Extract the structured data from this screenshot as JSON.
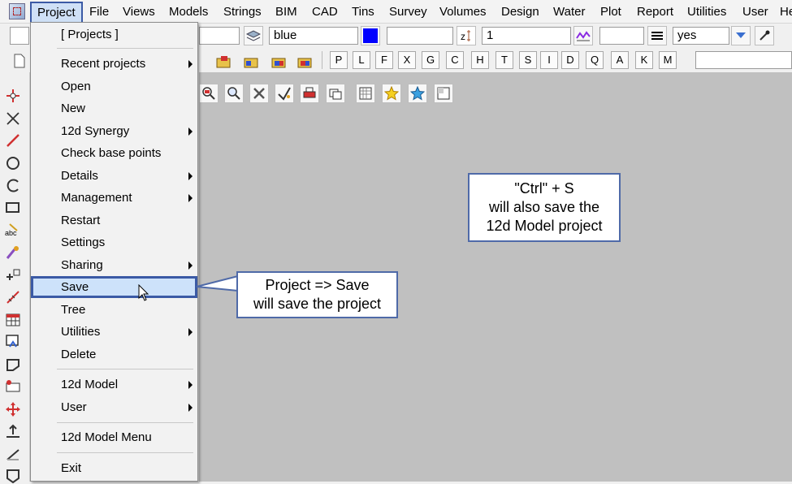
{
  "menubar": {
    "items": [
      "Project",
      "File",
      "Views",
      "Models",
      "Strings",
      "BIM",
      "CAD",
      "Tins",
      "Survey",
      "Volumes",
      "Design",
      "Water",
      "Plot",
      "Report",
      "Utilities",
      "User",
      "He"
    ]
  },
  "toolbar": {
    "colour_value": "blue",
    "colour_swatch": "#0000ff",
    "weight_value": "1",
    "toggle_value": "yes",
    "letters": [
      "P",
      "L",
      "F",
      "X",
      "G",
      "C",
      "H",
      "T",
      "S",
      "I",
      "D",
      "Q",
      "A",
      "K",
      "M"
    ]
  },
  "project_menu": {
    "items": [
      {
        "label": "[ Projects ]",
        "submenu": false
      },
      {
        "label": "Recent projects",
        "submenu": true
      },
      {
        "label": "Open",
        "submenu": false
      },
      {
        "label": "New",
        "submenu": false
      },
      {
        "label": "12d Synergy",
        "submenu": true
      },
      {
        "label": "Check base points",
        "submenu": false
      },
      {
        "label": "Details",
        "submenu": true
      },
      {
        "label": "Management",
        "submenu": true
      },
      {
        "label": "Restart",
        "submenu": false
      },
      {
        "label": "Settings",
        "submenu": false
      },
      {
        "label": "Sharing",
        "submenu": true
      },
      {
        "label": "Save",
        "submenu": false
      },
      {
        "label": "Tree",
        "submenu": false
      },
      {
        "label": "Utilities",
        "submenu": true
      },
      {
        "label": "Delete",
        "submenu": false
      },
      {
        "label": "12d Model",
        "submenu": true
      },
      {
        "label": "User",
        "submenu": true
      },
      {
        "label": "12d Model Menu",
        "submenu": false
      },
      {
        "label": "Exit",
        "submenu": false
      }
    ],
    "highlighted": "Save"
  },
  "callouts": {
    "save": {
      "line1": "Project => Save",
      "line2": "will save the project"
    },
    "shortcut": {
      "line1": "\"Ctrl\" + S",
      "line2": "will also save the",
      "line3": "12d Model project"
    }
  },
  "colors": {
    "highlight_border": "#3b5aa5",
    "highlight_fill": "#cde2fa",
    "canvas": "#c0c0c0"
  }
}
